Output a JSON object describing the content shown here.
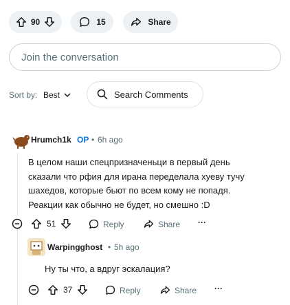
{
  "post_actions": {
    "votes": "90",
    "comments": "15",
    "share_label": "Share"
  },
  "join_placeholder": "Join the conversation",
  "sort": {
    "label": "Sort by:",
    "value": "Best"
  },
  "search_label": "Search Comments",
  "comments": [
    {
      "author": "Hrumch1k",
      "op_badge": "OP",
      "time": "6h ago",
      "text": "В целом наши спецпризначеньци в первый день сказали что рфия для ирана переделала хуеву тучу шахедов, которые бьют по всем кому не попадя. Реакции как обычно не будет, но смешно :D",
      "votes": "51",
      "reply_label": "Reply",
      "share_label": "Share",
      "more": "···"
    },
    {
      "author": "Warpingghost",
      "time": "5h ago",
      "text": "Ну ты что, а вдруг эскалация?",
      "votes": "37",
      "reply_label": "Reply",
      "share_label": "Share",
      "more": "···"
    }
  ],
  "meta_separator": "•",
  "colors": {
    "accent": "#0a73d9",
    "pill_bg": "#eef1f3",
    "muted": "#576f76"
  }
}
